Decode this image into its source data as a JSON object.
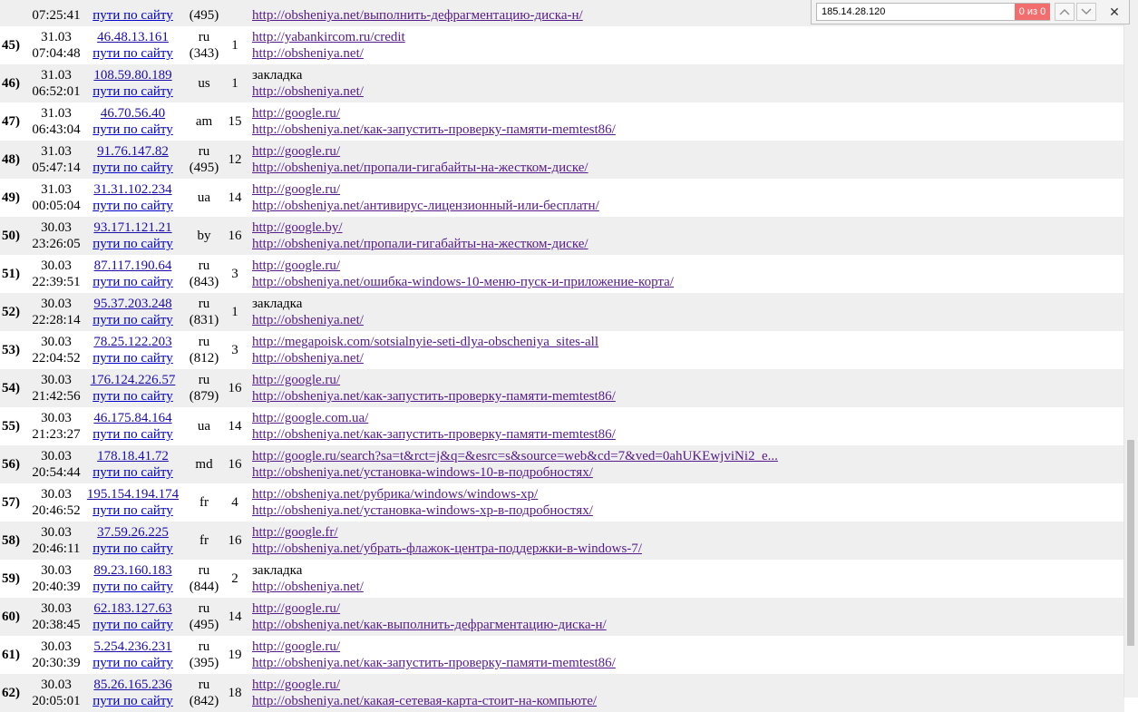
{
  "find_bar": {
    "query": "185.14.28.120",
    "match_count": "0 из 0",
    "prev_icon": "chevron-up-icon",
    "next_icon": "chevron-down-icon",
    "close_icon": "close-icon",
    "count_color": "#f26d6d"
  },
  "partial_top_row": {
    "time": "07:25:41",
    "ip_link": "пути по сайту",
    "region": "(495)",
    "page": "http://obsheniya.net/выполнить-дефрагментацию-диска-н/"
  },
  "visits": [
    {
      "num": "45)",
      "date": "31.03",
      "time": "07:04:48",
      "ip": "46.48.13.161",
      "path_link": "пути по сайту",
      "country": "ru",
      "region": "(343)",
      "depth": "1",
      "referrer": "http://yabankircom.ru/credit",
      "ref_link": true,
      "page": "http://obsheniya.net/"
    },
    {
      "num": "46)",
      "date": "31.03",
      "time": "06:52:01",
      "ip": "108.59.80.189",
      "path_link": "пути по сайту",
      "country": "us",
      "region": "",
      "depth": "1",
      "referrer": "закладка",
      "ref_link": false,
      "page": "http://obsheniya.net/"
    },
    {
      "num": "47)",
      "date": "31.03",
      "time": "06:43:04",
      "ip": "46.70.56.40",
      "path_link": "пути по сайту",
      "country": "am",
      "region": "",
      "depth": "15",
      "referrer": "http://google.ru/",
      "ref_link": true,
      "page": "http://obsheniya.net/как-запустить-проверку-памяти-memtest86/"
    },
    {
      "num": "48)",
      "date": "31.03",
      "time": "05:47:14",
      "ip": "91.76.147.82",
      "path_link": "пути по сайту",
      "country": "ru",
      "region": "(495)",
      "depth": "12",
      "referrer": "http://google.ru/",
      "ref_link": true,
      "page": "http://obsheniya.net/пропали-гигабайты-на-жестком-диске/"
    },
    {
      "num": "49)",
      "date": "31.03",
      "time": "00:05:04",
      "ip": "31.31.102.234",
      "path_link": "пути по сайту",
      "country": "ua",
      "region": "",
      "depth": "14",
      "referrer": "http://google.ru/",
      "ref_link": true,
      "page": "http://obsheniya.net/антивирус-лицензионный-или-бесплатн/"
    },
    {
      "num": "50)",
      "date": "30.03",
      "time": "23:26:05",
      "ip": "93.171.121.21",
      "path_link": "пути по сайту",
      "country": "by",
      "region": "",
      "depth": "16",
      "referrer": "http://google.by/",
      "ref_link": true,
      "page": "http://obsheniya.net/пропали-гигабайты-на-жестком-диске/"
    },
    {
      "num": "51)",
      "date": "30.03",
      "time": "22:39:51",
      "ip": "87.117.190.64",
      "path_link": "пути по сайту",
      "country": "ru",
      "region": "(843)",
      "depth": "3",
      "referrer": "http://google.ru/",
      "ref_link": true,
      "page": "http://obsheniya.net/ошибка-windows-10-меню-пуск-и-приложение-корта/"
    },
    {
      "num": "52)",
      "date": "30.03",
      "time": "22:28:14",
      "ip": "95.37.203.248",
      "path_link": "пути по сайту",
      "country": "ru",
      "region": "(831)",
      "depth": "1",
      "referrer": "закладка",
      "ref_link": false,
      "page": "http://obsheniya.net/"
    },
    {
      "num": "53)",
      "date": "30.03",
      "time": "22:04:52",
      "ip": "78.25.122.203",
      "path_link": "пути по сайту",
      "country": "ru",
      "region": "(812)",
      "depth": "3",
      "referrer": "http://megapoisk.com/sotsialnyie-seti-dlya-obscheniya_sites-all",
      "ref_link": true,
      "page": "http://obsheniya.net/"
    },
    {
      "num": "54)",
      "date": "30.03",
      "time": "21:42:56",
      "ip": "176.124.226.57",
      "path_link": "пути по сайту",
      "country": "ru",
      "region": "(879)",
      "depth": "16",
      "referrer": "http://google.ru/",
      "ref_link": true,
      "page": "http://obsheniya.net/как-запустить-проверку-памяти-memtest86/"
    },
    {
      "num": "55)",
      "date": "30.03",
      "time": "21:23:27",
      "ip": "46.175.84.164",
      "path_link": "пути по сайту",
      "country": "ua",
      "region": "",
      "depth": "14",
      "referrer": "http://google.com.ua/",
      "ref_link": true,
      "page": "http://obsheniya.net/как-запустить-проверку-памяти-memtest86/"
    },
    {
      "num": "56)",
      "date": "30.03",
      "time": "20:54:44",
      "ip": "178.18.41.72",
      "path_link": "пути по сайту",
      "country": "md",
      "region": "",
      "depth": "16",
      "referrer": "http://google.ru/search?sa=t&rct=j&q=&esrc=s&source=web&cd=7&ved=0ahUKEwjviNi2_e...",
      "ref_link": true,
      "page": "http://obsheniya.net/установка-windows-10-в-подробностях/"
    },
    {
      "num": "57)",
      "date": "30.03",
      "time": "20:46:52",
      "ip": "195.154.194.174",
      "path_link": "пути по сайту",
      "country": "fr",
      "region": "",
      "depth": "4",
      "referrer": "http://obsheniya.net/рубрика/windows/windows-xp/",
      "ref_link": true,
      "page": "http://obsheniya.net/установка-windows-xp-в-подробностях/"
    },
    {
      "num": "58)",
      "date": "30.03",
      "time": "20:46:11",
      "ip": "37.59.26.225",
      "path_link": "пути по сайту",
      "country": "fr",
      "region": "",
      "depth": "16",
      "referrer": "http://google.fr/",
      "ref_link": true,
      "page": "http://obsheniya.net/убрать-флажок-центра-поддержки-в-windows-7/"
    },
    {
      "num": "59)",
      "date": "30.03",
      "time": "20:40:39",
      "ip": "89.23.160.183",
      "path_link": "пути по сайту",
      "country": "ru",
      "region": "(844)",
      "depth": "2",
      "referrer": "закладка",
      "ref_link": false,
      "page": "http://obsheniya.net/"
    },
    {
      "num": "60)",
      "date": "30.03",
      "time": "20:38:45",
      "ip": "62.183.127.63",
      "path_link": "пути по сайту",
      "country": "ru",
      "region": "(495)",
      "depth": "14",
      "referrer": "http://google.ru/",
      "ref_link": true,
      "page": "http://obsheniya.net/как-выполнить-дефрагментацию-диска-н/"
    },
    {
      "num": "61)",
      "date": "30.03",
      "time": "20:30:39",
      "ip": "5.254.236.231",
      "path_link": "пути по сайту",
      "country": "ru",
      "region": "(395)",
      "depth": "19",
      "referrer": "http://google.ru/",
      "ref_link": true,
      "page": "http://obsheniya.net/как-запустить-проверку-памяти-memtest86/"
    },
    {
      "num": "62)",
      "date": "30.03",
      "time": "20:05:01",
      "ip": "85.26.165.236",
      "path_link": "пути по сайту",
      "country": "ru",
      "region": "(842)",
      "depth": "18",
      "referrer": "http://google.ru/",
      "ref_link": true,
      "page": "http://obsheniya.net/какая-сетевая-карта-стоит-на-компьюте/"
    }
  ]
}
